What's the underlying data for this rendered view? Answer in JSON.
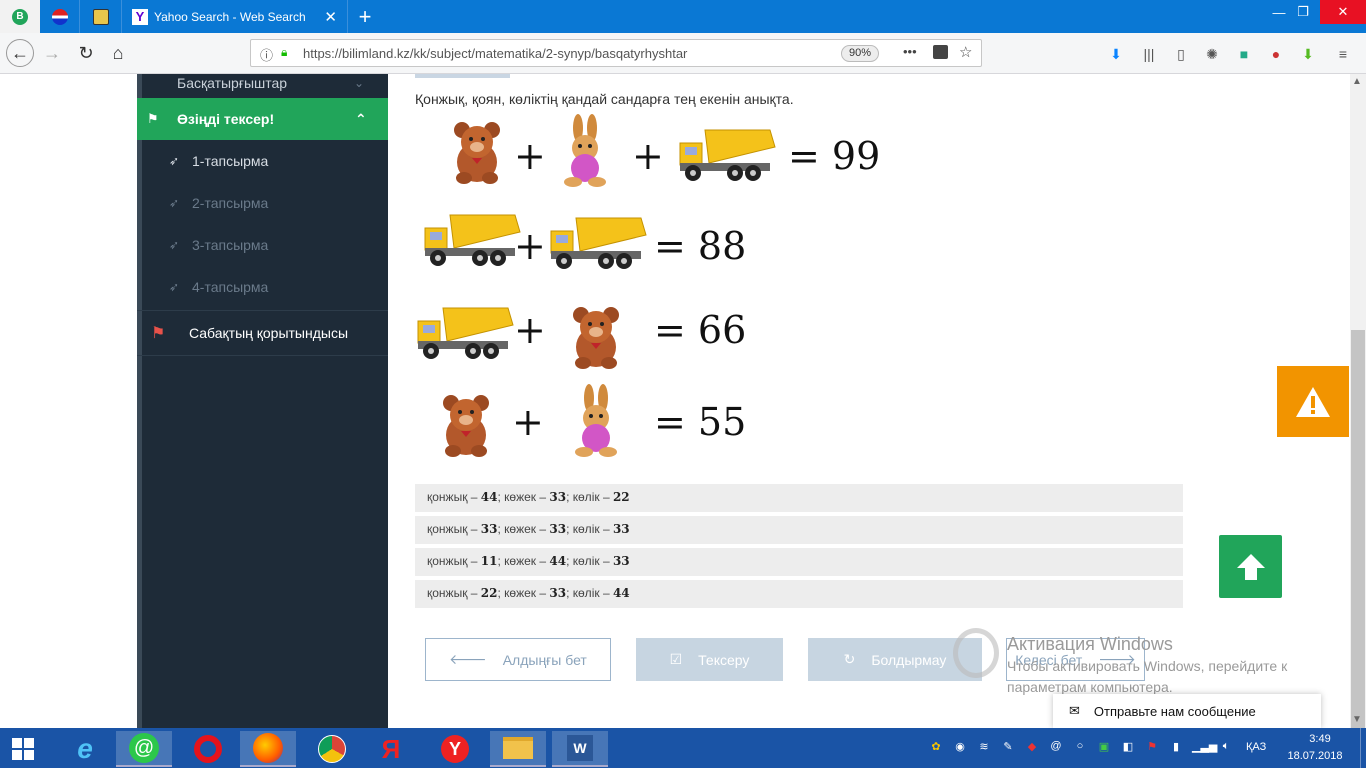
{
  "browser": {
    "tabs": [
      {
        "label": "",
        "icon": "bilimland-icon"
      },
      {
        "label": "",
        "icon": "pepsi-icon"
      },
      {
        "label": "",
        "icon": "shield-crest-icon"
      },
      {
        "label": "Yahoo Search - Web Search",
        "icon": "yahoo-icon"
      }
    ],
    "new_tab": "+",
    "url": "https://bilimland.kz/kk/subject/matematika/2-synyp/basqatyrhyshtar",
    "zoom": "90%",
    "more": "•••"
  },
  "sidebar": {
    "top_item": "Басқатырғыштар",
    "section": "Өзіңді тексер!",
    "tasks": [
      "1-тапсырма",
      "2-тапсырма",
      "3-тапсырма",
      "4-тапсырма"
    ],
    "summary": "Сабақтың қорытындысы"
  },
  "main": {
    "question": "Қонжық, қоян, көліктің қандай сандарға тең екенін анықта.",
    "equations": [
      "= 99",
      "= 88",
      "= 66",
      "= 55"
    ],
    "plus": "+",
    "options": [
      {
        "a": "қонжық – ",
        "av": "44",
        "b": "; көжек – ",
        "bv": "33",
        "c": "; көлік – ",
        "cv": "22"
      },
      {
        "a": "қонжық – ",
        "av": "33",
        "b": "; көжек – ",
        "bv": "33",
        "c": "; көлік – ",
        "cv": "33"
      },
      {
        "a": "қонжық – ",
        "av": "11",
        "b": "; көжек – ",
        "bv": "44",
        "c": "; көлік – ",
        "cv": "33"
      },
      {
        "a": "қонжық – ",
        "av": "22",
        "b": "; көжек – ",
        "bv": "33",
        "c": "; көлік – ",
        "cv": "44"
      }
    ],
    "buttons": {
      "prev": "Алдыңғы бет",
      "check": "Тексеру",
      "cancel": "Болдырмау",
      "next": "Келесі бет"
    }
  },
  "overlay": {
    "watermark_title": "Активация Windows",
    "watermark_line1": "Чтобы активировать Windows, перейдите к",
    "watermark_line2": "параметрам компьютера.",
    "chat": "Отправьте нам сообщение"
  },
  "taskbar": {
    "lang": "ҚАЗ",
    "time": "3:49",
    "date": "18.07.2018"
  },
  "colors": {
    "accent": "#21a55a",
    "sidebar": "#1e2b38",
    "warn": "#f29400",
    "taskbar": "#1a54a6"
  }
}
